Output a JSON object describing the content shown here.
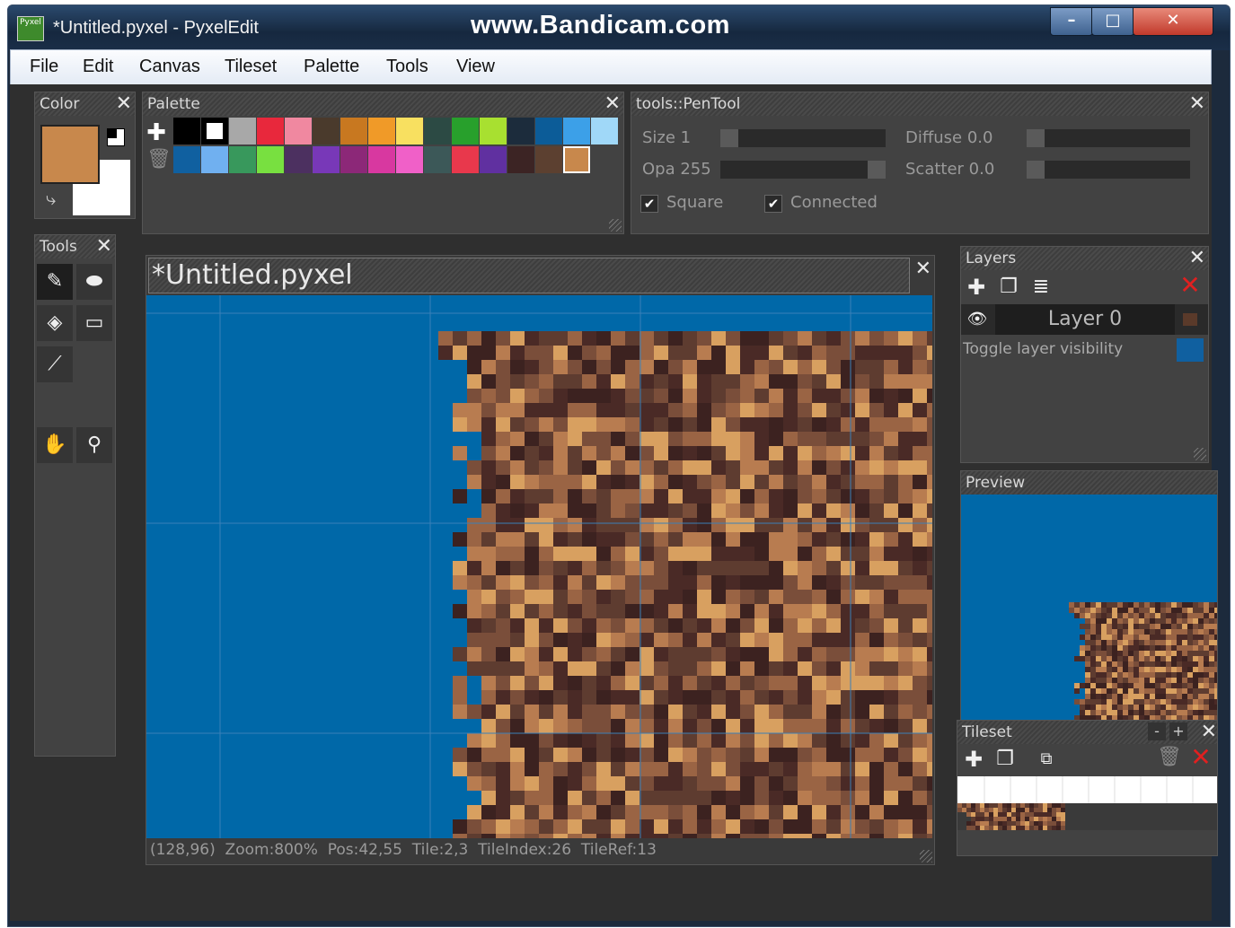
{
  "window": {
    "title": "*Untitled.pyxel - PyxelEdit",
    "watermark": "www.Bandicam.com",
    "app_icon_text": "Pyxel",
    "min_symbol": "–",
    "max_symbol": "□",
    "close_symbol": "✕"
  },
  "menu": [
    "File",
    "Edit",
    "Canvas",
    "Tileset",
    "Palette",
    "Tools",
    "View"
  ],
  "color_panel": {
    "title": "Color",
    "primary_color": "#c8884c",
    "secondary_color": "#ffffff"
  },
  "palette_panel": {
    "title": "Palette",
    "row1": [
      "#000000",
      "#ffffff",
      "#a8a8a8",
      "#e8283c",
      "#f088a0",
      "#4a3a2c",
      "#c87820",
      "#f09a28",
      "#f8e060",
      "#2c4a44",
      "#28a02c",
      "#a8e030",
      "#1c2c3c",
      "#0c5c98",
      "#3ca0e8",
      "#a0d8f8"
    ],
    "row2": [
      "#1060a0",
      "#70b0f0",
      "#38985c",
      "#78e040",
      "#4c3060",
      "#7838b8",
      "#8c2878",
      "#d838a0",
      "#f060c8",
      "#3c5858",
      "#e8384c",
      "#6030a0",
      "#3c2424",
      "#5c4030",
      "#c8884c"
    ]
  },
  "tool_options": {
    "title": "tools::PenTool",
    "size_label": "Size 1",
    "opacity_label": "Opa 255",
    "diffuse_label": "Diffuse 0.0",
    "scatter_label": "Scatter 0.0",
    "size_value": 1,
    "opacity_value": 255,
    "diffuse_value": 0.0,
    "scatter_value": 0.0,
    "square_label": "Square",
    "connected_label": "Connected",
    "square_checked": true,
    "connected_checked": true
  },
  "tools_panel": {
    "title": "Tools",
    "tools": [
      "pen-icon",
      "eraser-icon",
      "fill-bucket-icon",
      "select-icon",
      "eyedropper-icon",
      "hand-icon",
      "zoom-icon"
    ]
  },
  "canvas": {
    "title": "*Untitled.pyxel",
    "status": "(128,96)  Zoom:800%  Pos:42,55  Tile:2,3  TileIndex:26  TileRef:13",
    "background_color": "#0068a8"
  },
  "layers_panel": {
    "title": "Layers",
    "layer_name": "Layer 0",
    "tooltip": "Toggle layer visibility"
  },
  "preview_panel": {
    "title": "Preview"
  },
  "tileset_panel": {
    "title": "Tileset",
    "minus": "-",
    "plus": "+"
  },
  "close_symbol": "✕"
}
